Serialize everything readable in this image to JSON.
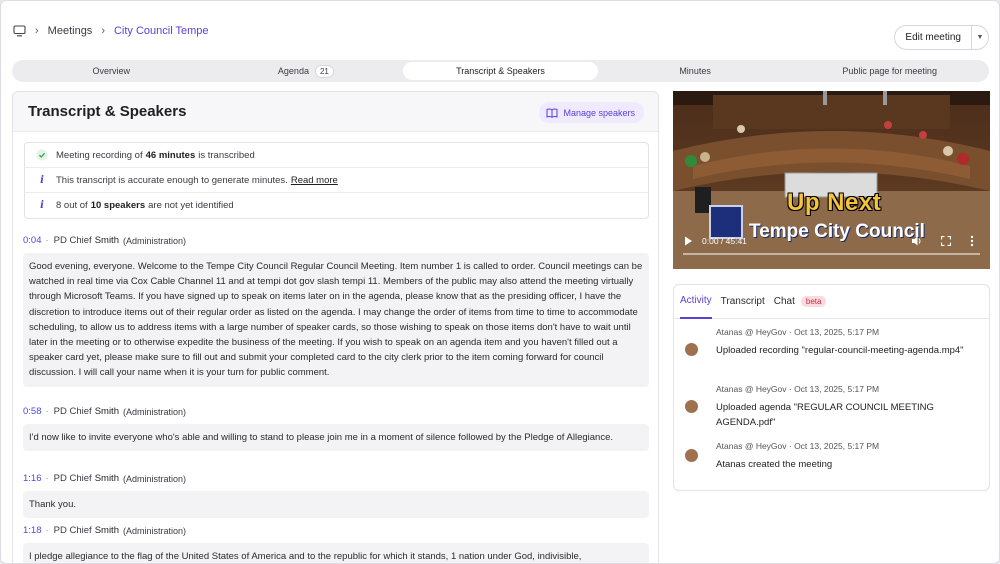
{
  "breadcrumb": {
    "root": "Meetings",
    "current": "City Council Tempe"
  },
  "header": {
    "edit_label": "Edit meeting"
  },
  "tabs": [
    {
      "label": "Overview"
    },
    {
      "label": "Agenda",
      "count": "21"
    },
    {
      "label": "Transcript & Speakers"
    },
    {
      "label": "Minutes"
    },
    {
      "label": "Public page for meeting"
    }
  ],
  "transcript": {
    "title": "Transcript & Speakers",
    "manage_label": "Manage speakers",
    "status": {
      "rec_pre": "Meeting recording of",
      "rec_bold": "46 minutes",
      "rec_post": "is transcribed",
      "accuracy": "This transcript is accurate enough to generate minutes.",
      "read_more": "Read more",
      "spk_pre": "8 out of",
      "spk_bold": "10 speakers",
      "spk_post": "are not yet identified"
    },
    "segments": [
      {
        "time": "0:04",
        "title": "PD Chief",
        "name": "Smith",
        "role": "(Administration)",
        "text": "Good evening, everyone. Welcome to the Tempe City Council Regular Council Meeting. Item number 1 is called to order. Council meetings can be watched in real time via Cox Cable Channel 11 and at tempi dot gov slash tempi 11. Members of the public may also attend the meeting virtually through Microsoft Teams. If you have signed up to speak on items later on in the agenda, please know that as the presiding officer, I have the discretion to introduce items out of their regular order as listed on the agenda. I may change the order of items from time to time to accommodate scheduling, to allow us to address items with a large number of speaker cards, so those wishing to speak on those items don't have to wait until later in the meeting or to otherwise expedite the business of the meeting. If you wish to speak on an agenda item and you haven't filled out a speaker card yet, please make sure to fill out and submit your completed card to the city clerk prior to the item coming forward for council discussion. I will call your name when it is your turn for public comment."
      },
      {
        "time": "0:58",
        "title": "PD Chief",
        "name": "Smith",
        "role": "(Administration)",
        "text": "I'd now like to invite everyone who's able and willing to stand to please join me in a moment of silence followed by the Pledge of Allegiance."
      },
      {
        "time": "1:16",
        "title": "PD Chief",
        "name": "Smith",
        "role": "(Administration)",
        "text": "Thank you."
      },
      {
        "time": "1:18",
        "title": "PD Chief",
        "name": "Smith",
        "role": "(Administration)",
        "text": "I pledge allegiance to the flag of the United States of America and to the republic for which it stands, 1 nation under God, indivisible,"
      }
    ]
  },
  "video": {
    "overlay_line1": "Up Next",
    "overlay_line2": "Tempe City Council",
    "time": "0:00 / 45:41"
  },
  "activity": {
    "tabs": [
      "Activity",
      "Transcript",
      "Chat"
    ],
    "beta": "beta",
    "items": [
      {
        "meta": "Atanas @ HeyGov · Oct 13, 2025, 5:17 PM",
        "text": "Uploaded recording \"regular-council-meeting-agenda.mp4\""
      },
      {
        "meta": "Atanas @ HeyGov · Oct 13, 2025, 5:17 PM",
        "text": "Uploaded agenda \"REGULAR COUNCIL MEETING AGENDA.pdf\""
      },
      {
        "meta": "Atanas @ HeyGov · Oct 13, 2025, 5:17 PM",
        "text": "Atanas created the meeting"
      }
    ]
  },
  "colors": {
    "accent": "#5b3fd6",
    "timestamp": "#4a4ad8",
    "beta_bg": "#fbdadd",
    "up_next": "#f4c53a"
  },
  "icons": [
    "monitor-icon",
    "chevron-right-icon",
    "chevron-down-icon",
    "book-icon",
    "check-circle-icon",
    "info-icon",
    "play-icon",
    "volume-icon",
    "fullscreen-icon",
    "more-vertical-icon"
  ]
}
